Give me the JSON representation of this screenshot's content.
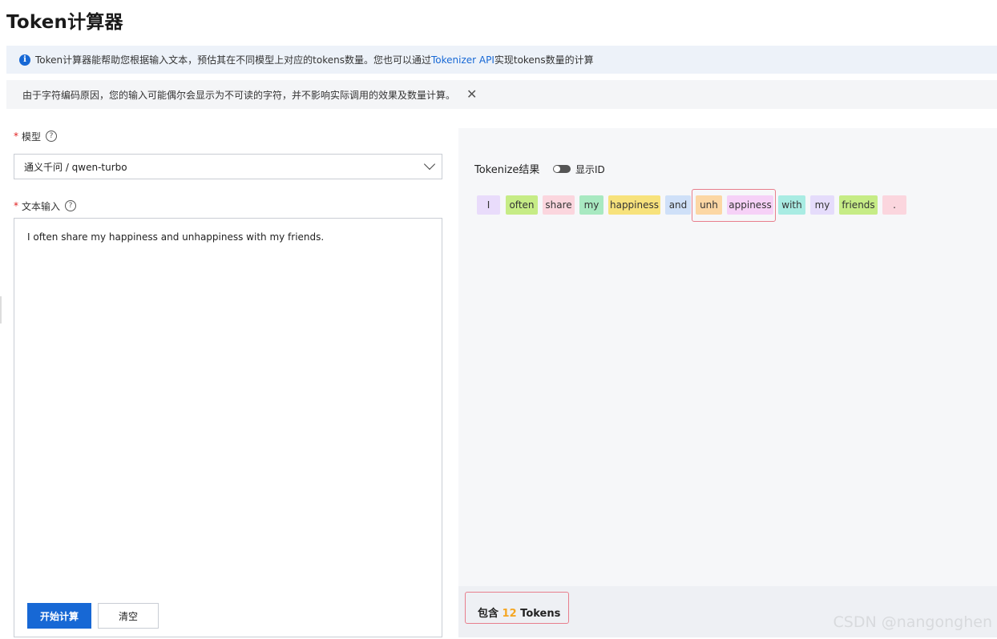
{
  "page": {
    "title": "Token计算器"
  },
  "info_bar": {
    "icon": "info-icon",
    "text_before": "Token计算器能帮助您根据输入文本，预估其在不同模型上对应的tokens数量。您也可以通过",
    "link_text": "Tokenizer API",
    "text_after": "实现tokens数量的计算"
  },
  "notice_bar": {
    "text": "由于字符编码原因，您的输入可能偶尔会显示为不可读的字符，并不影响实际调用的效果及数量计算。",
    "close_icon": "close-icon"
  },
  "form": {
    "model_label": "模型",
    "model_value": "通义千问 / qwen-turbo",
    "text_label": "文本输入",
    "required_mark": "*",
    "help_icon": "?",
    "text_value": "I often share my happiness and unhappiness with my friends.",
    "submit_label": "开始计算",
    "clear_label": "清空"
  },
  "result": {
    "label": "Tokenize结果",
    "toggle_label": "显示ID",
    "tokens": [
      {
        "text": "I",
        "color": "#e9dcfb"
      },
      {
        "text": "often",
        "color": "#c6ec86"
      },
      {
        "text": "share",
        "color": "#fbd6de"
      },
      {
        "text": "my",
        "color": "#a8e9c1"
      },
      {
        "text": "happiness",
        "color": "#f7e27c"
      },
      {
        "text": "and",
        "color": "#cfe0f8"
      },
      {
        "text": "unh",
        "color": "#fcd7a4"
      },
      {
        "text": "appiness",
        "color": "#f6d1f7"
      },
      {
        "text": "with",
        "color": "#a9ece3"
      },
      {
        "text": "my",
        "color": "#e5dcfb"
      },
      {
        "text": "friends",
        "color": "#c6ec86"
      },
      {
        "text": ".",
        "color": "#fbd6de"
      }
    ],
    "count_prefix": "包含",
    "count_value": "12",
    "count_suffix": "Tokens"
  },
  "watermark": "CSDN @nangonghen"
}
